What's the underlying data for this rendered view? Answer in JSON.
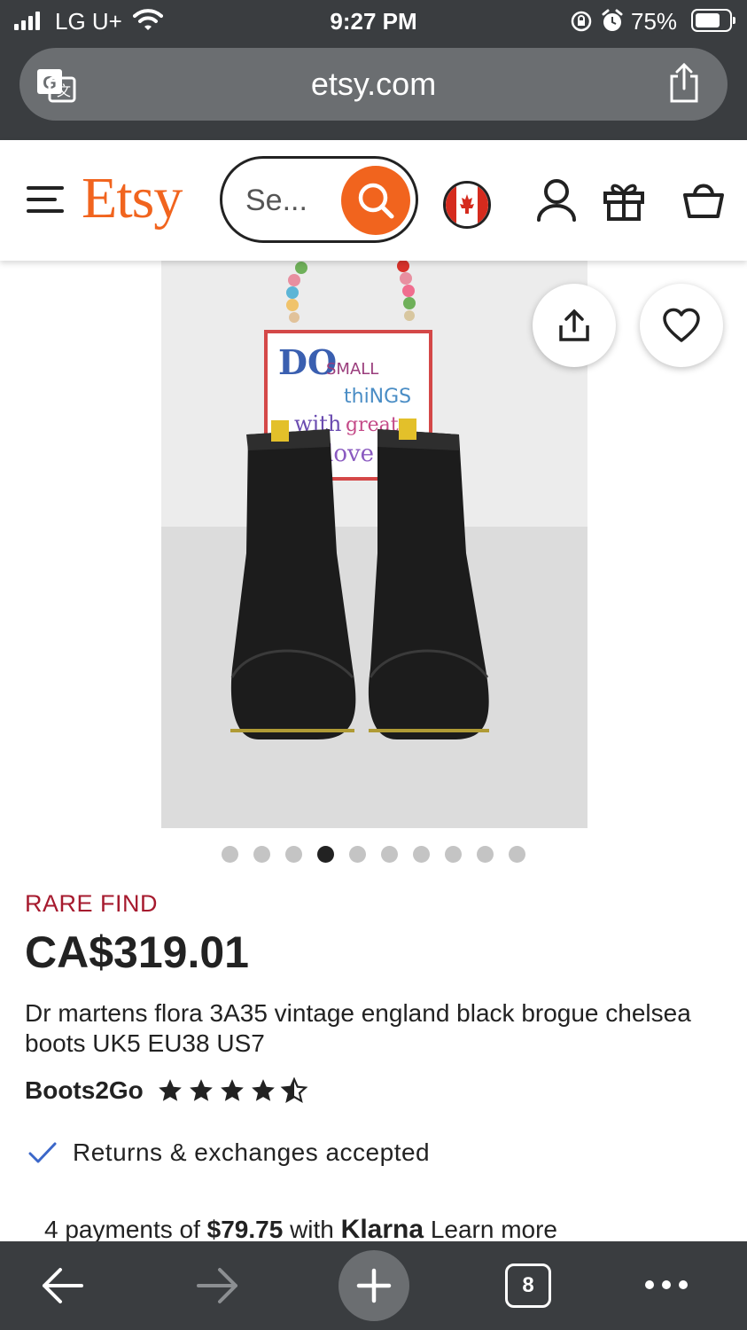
{
  "status_bar": {
    "carrier": "LG U+",
    "time": "9:27 PM",
    "battery_percent": "75%",
    "battery_level": 0.75
  },
  "browser": {
    "url": "etsy.com",
    "tab_count": "8"
  },
  "header": {
    "logo": "Etsy",
    "search_placeholder": "Se...",
    "country_flag": "canada-flag-icon",
    "brand_color": "#f1641e"
  },
  "gallery": {
    "image_count": 10,
    "active_index": 3
  },
  "product": {
    "badge": "RARE FIND",
    "badge_color": "#a61a2e",
    "price": "CA$319.01",
    "title": "Dr martens flora 3A35 vintage england black brogue chelsea boots UK5 EU38 US7",
    "shop_name": "Boots2Go",
    "rating": 4.5,
    "returns_text": "Returns & exchanges accepted",
    "klarna": {
      "prefix": "4 payments of",
      "amount": "$79.75",
      "middle": "with",
      "brand": "Klarna",
      "link": "Learn more"
    }
  }
}
